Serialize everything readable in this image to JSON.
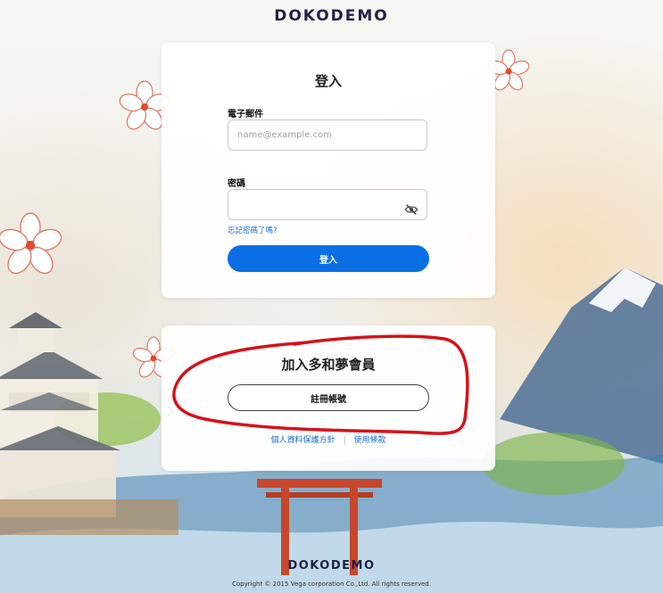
{
  "brand": {
    "logo": "DOKODEMO"
  },
  "login": {
    "title": "登入",
    "email_label": "電子郵件",
    "email_placeholder": "name@example.com",
    "email_value": "",
    "password_label": "密碼",
    "password_value": "",
    "forgot_link": "忘記密碼了嗎?",
    "submit_label": "登入"
  },
  "join": {
    "title": "加入多和夢會員",
    "register_label": "註冊帳號",
    "privacy_link": "個人資料保護方針",
    "terms_link": "使用條款"
  },
  "footer": {
    "logo": "DOKODEMO",
    "copyright": "Copyright © 2015 Vega corporation Co.,Ltd. All rights reserved."
  },
  "colors": {
    "primary": "#0a6fe4",
    "link": "#1a6fd0",
    "annotation": "#d4121b",
    "brand_text": "#1e2346"
  },
  "icons": {
    "password_toggle": "eye-off-icon"
  }
}
